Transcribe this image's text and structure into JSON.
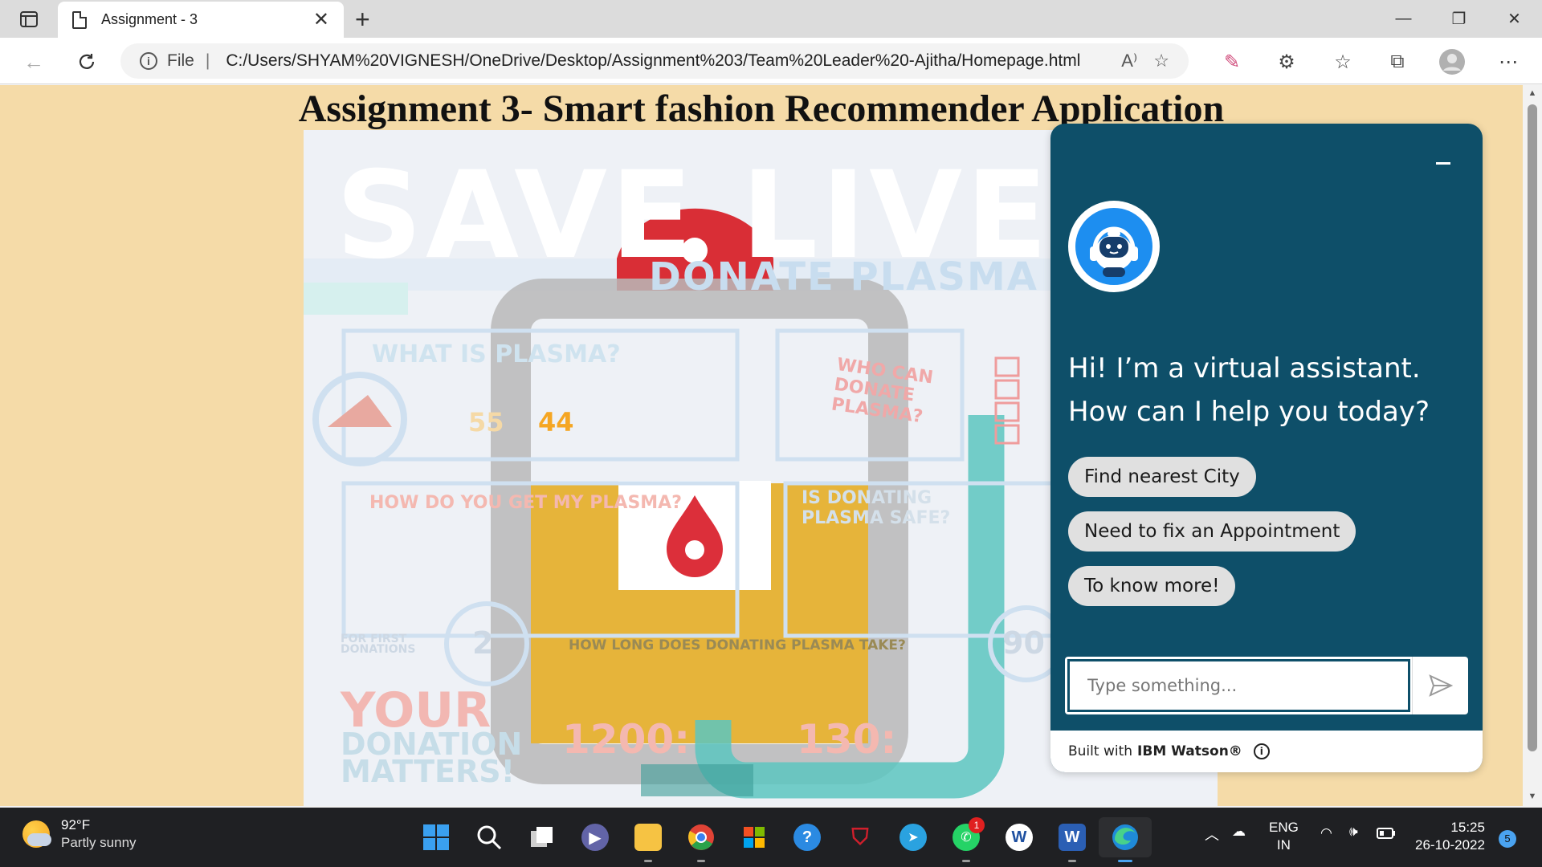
{
  "browser": {
    "tab_title": "Assignment - 3",
    "url_scheme_label": "File",
    "url": "C:/Users/SHYAM%20VIGNESH/OneDrive/Desktop/Assignment%203/Team%20Leader%20-Ajitha/Homepage.html"
  },
  "page": {
    "heading": "Assignment 3- Smart fashion Recommender Application",
    "poster": {
      "headline": "SAVE LIVE",
      "subheadline": "DONATE PLASMA T",
      "what_is_plasma": "WHAT IS PLASMA?",
      "who_can_donate": "WHO CAN DONATE PLASMA?",
      "how_get_plasma": "HOW DO YOU GET MY PLASMA?",
      "is_donating_safe": "IS DONATING PLASMA SAFE?",
      "how_long": "HOW LONG DOES DONATING PLASMA TAKE?",
      "for_first": "FOR FIRST DONATIONS",
      "your": "YOUR",
      "donation_matters": "DONATION MATTERS!",
      "stat_1200": "1200:",
      "stat_130": "130:",
      "stat_55": "55",
      "stat_44": "44",
      "stat_2": "2",
      "stat_90": "90"
    }
  },
  "chat": {
    "greeting": "Hi! I’m a virtual assistant. How can I help you today?",
    "options": [
      "Find nearest City",
      "Need to fix an Appointment",
      "To know more!"
    ],
    "input_placeholder": "Type something...",
    "footer_prefix": "Built with",
    "footer_brand": "IBM Watson®",
    "accent": "#0e4f69"
  },
  "taskbar": {
    "temperature": "92°F",
    "condition": "Partly sunny",
    "lang_1": "ENG",
    "lang_2": "IN",
    "time": "15:25",
    "date": "26-10-2022",
    "whatsapp_badge": "1",
    "notification_count": "5"
  }
}
